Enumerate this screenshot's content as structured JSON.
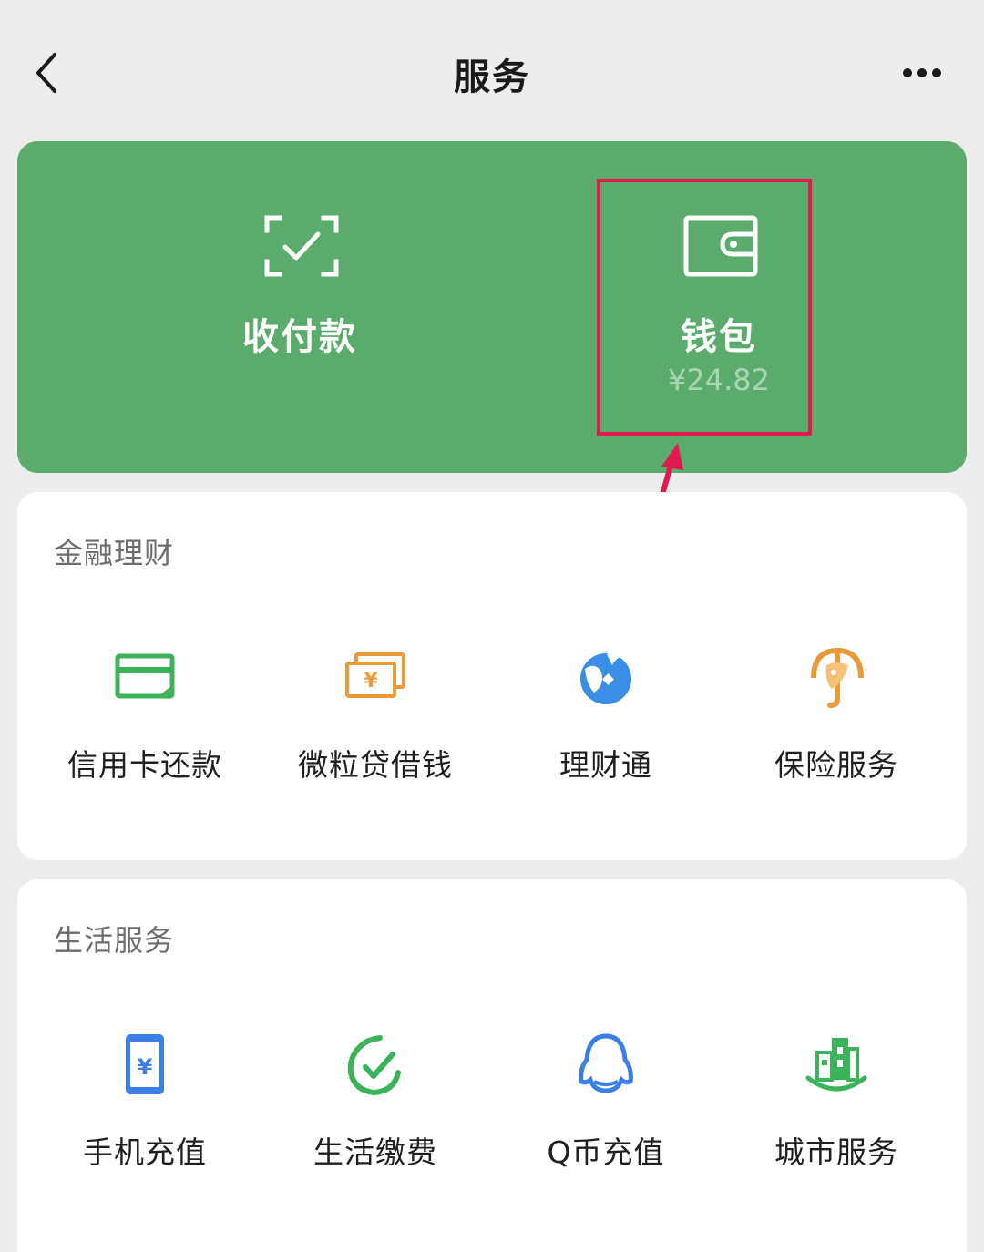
{
  "header": {
    "title": "服务",
    "back_icon": "chevron-left-icon",
    "more_icon": "more-dots-icon"
  },
  "top_card": {
    "pay": {
      "label": "收付款",
      "icon": "scan-check-icon"
    },
    "wallet": {
      "label": "钱包",
      "amount": "¥24.82",
      "icon": "wallet-icon"
    },
    "bg_color": "#5aab6c"
  },
  "annotation": {
    "color": "#e0194f"
  },
  "finance": {
    "title": "金融理财",
    "items": [
      {
        "label": "信用卡还款",
        "icon": "credit-card-icon",
        "color": "#3bb35b"
      },
      {
        "label": "微粒贷借钱",
        "icon": "yuan-bills-icon",
        "color": "#e99a3a"
      },
      {
        "label": "理财通",
        "icon": "wealth-fish-icon",
        "color": "#3b8ee6"
      },
      {
        "label": "保险服务",
        "icon": "insurance-umbrella-icon",
        "color": "#e99a3a"
      }
    ]
  },
  "life": {
    "title": "生活服务",
    "items": [
      {
        "label": "手机充值",
        "icon": "phone-topup-icon",
        "color": "#3b7fe6"
      },
      {
        "label": "生活缴费",
        "icon": "bill-check-icon",
        "color": "#3bb35b"
      },
      {
        "label": "Q币充值",
        "icon": "qq-penguin-icon",
        "color": "#3b7fe6"
      },
      {
        "label": "城市服务",
        "icon": "city-buildings-icon",
        "color": "#3bb35b"
      }
    ]
  }
}
